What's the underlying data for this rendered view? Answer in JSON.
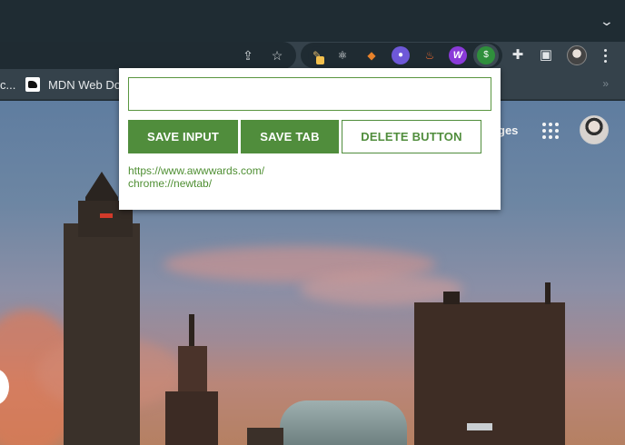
{
  "browser": {
    "bookmarks": {
      "cut_item": "c...",
      "mdn_label": "MDN Web Docs",
      "overflow": "»"
    },
    "toolbar_icons": [
      "share-icon",
      "star-icon",
      "puzzle-icon",
      "side-panel-icon",
      "profile-avatar",
      "menu-icon"
    ],
    "extensions": [
      "pencil-ext-icon",
      "react-ext-icon",
      "metamask-ext-icon",
      "ghost-ext-icon",
      "flame-ext-icon",
      "w-ext-icon",
      "money-bag-ext-icon"
    ]
  },
  "page": {
    "header_link": "ges",
    "apps_icon": "apps-grid-icon"
  },
  "popup": {
    "input": {
      "value": "",
      "placeholder": ""
    },
    "buttons": {
      "save_input": "SAVE INPUT",
      "save_tab": "SAVE TAB",
      "delete": "DELETE BUTTON"
    },
    "links": [
      "https://www.awwwards.com/",
      "chrome://newtab/"
    ]
  },
  "colors": {
    "accent_green": "#508d3c",
    "link_green": "#4f8f33",
    "chrome_dark": "#1f2c33",
    "toolbar": "#35424b"
  }
}
